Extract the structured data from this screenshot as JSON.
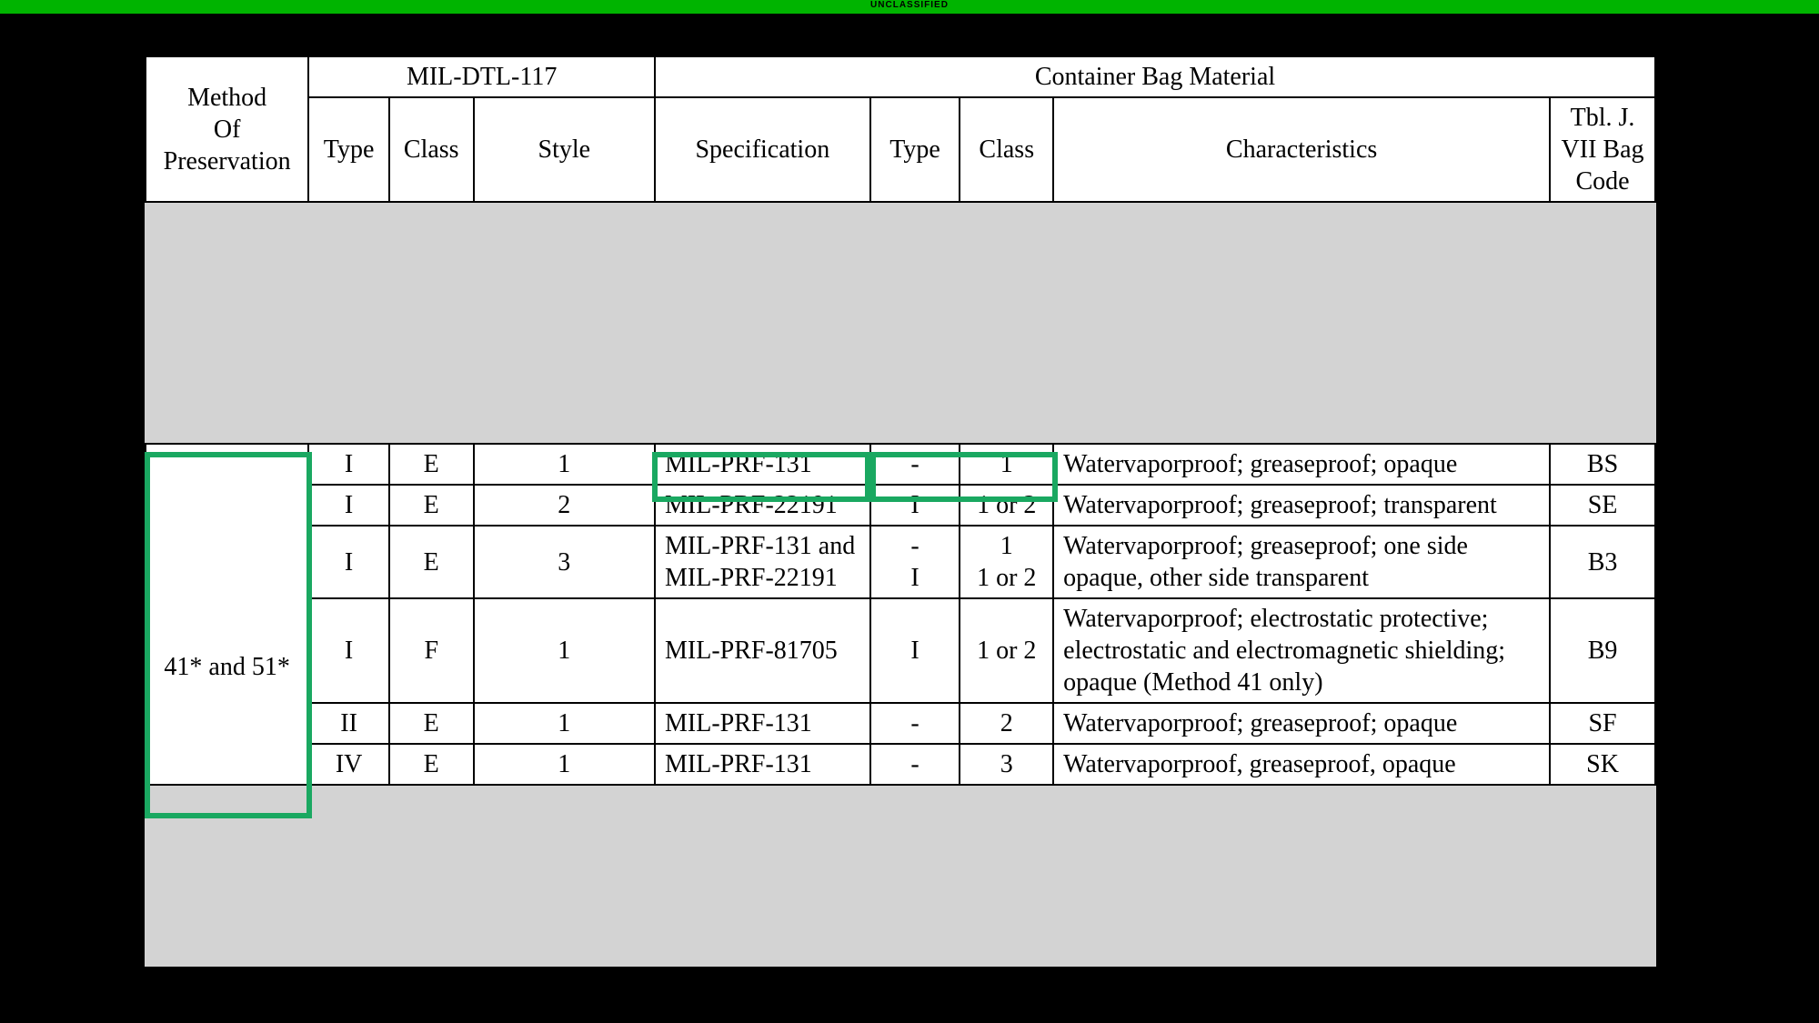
{
  "classification": "UNCLASSIFIED",
  "headers": {
    "mop": "Method\nOf\nPreservation",
    "mil117": "MIL-DTL-117",
    "container": "Container Bag Material",
    "type": "Type",
    "class": "Class",
    "style": "Style",
    "spec": "Specification",
    "type2": "Type",
    "class2": "Class",
    "char": "Characteristics",
    "bag": "Tbl. J. VII Bag Code"
  },
  "method_label": "41* and 51*",
  "rows": [
    {
      "t": "I",
      "c": "E",
      "s": "1",
      "spec": "MIL-PRF-131",
      "t2": "-",
      "c2": "1",
      "char": "Watervaporproof; greaseproof; opaque",
      "bag": "BS"
    },
    {
      "t": "I",
      "c": "E",
      "s": "2",
      "spec": "MIL-PRF-22191",
      "t2": "I",
      "c2": "1 or 2",
      "char": "Watervaporproof; greaseproof; transparent",
      "bag": "SE"
    },
    {
      "t": "I",
      "c": "E",
      "s": "3",
      "spec": "MIL-PRF-131 and MIL-PRF-22191",
      "t2": "-\nI",
      "c2": "1\n1 or 2",
      "char": "Watervaporproof; greaseproof; one side opaque, other side transparent",
      "bag": "B3"
    },
    {
      "t": "I",
      "c": "F",
      "s": "1",
      "spec": "MIL-PRF-81705",
      "t2": "I",
      "c2": "1 or 2",
      "char": "Watervaporproof; electrostatic protective; electrostatic and electromagnetic shielding; opaque (Method 41 only)",
      "bag": "B9"
    },
    {
      "t": "II",
      "c": "E",
      "s": "1",
      "spec": "MIL-PRF-131",
      "t2": "-",
      "c2": "2",
      "char": "Watervaporproof; greaseproof; opaque",
      "bag": "SF"
    },
    {
      "t": "IV",
      "c": "E",
      "s": "1",
      "spec": "MIL-PRF-131",
      "t2": "-",
      "c2": "3",
      "char": "Watervaporproof, greaseproof, opaque",
      "bag": "SK"
    }
  ]
}
